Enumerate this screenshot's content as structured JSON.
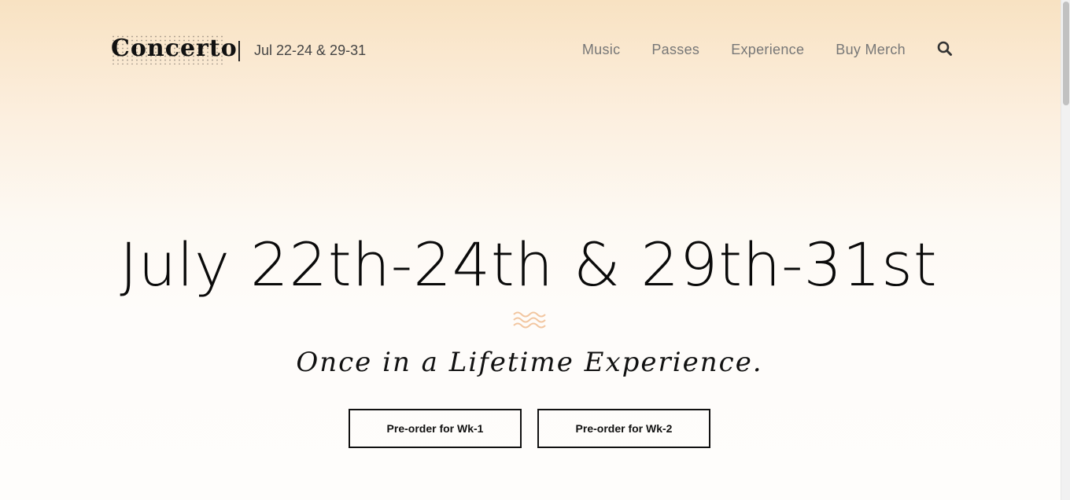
{
  "header": {
    "logo": "Concerto",
    "dates": "Jul 22-24 & 29-31",
    "nav": [
      "Music",
      "Passes",
      "Experience",
      "Buy Merch"
    ],
    "search_icon": "search-icon"
  },
  "hero": {
    "title": "July 22th-24th & 29th-31st",
    "divider_icon": "waves-icon",
    "tagline": "Once in a Lifetime Experience.",
    "buttons": [
      "Pre-order for Wk-1",
      "Pre-order for Wk-2"
    ]
  },
  "colors": {
    "accent": "#f2c6a0",
    "header_bg": "#f8e2c2",
    "text": "#111111"
  }
}
